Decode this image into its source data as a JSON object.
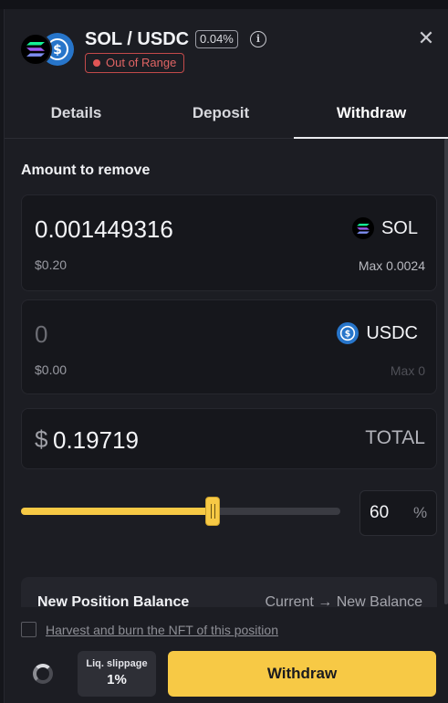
{
  "header": {
    "pair": "SOL / USDC",
    "fee": "0.04%",
    "status": "Out of Range",
    "token_a_icon": "solana-icon",
    "token_b_icon": "usdc-icon",
    "status_color": "#e05555"
  },
  "tabs": [
    {
      "label": "Details"
    },
    {
      "label": "Deposit"
    },
    {
      "label": "Withdraw",
      "active": true
    }
  ],
  "form": {
    "section_label": "Amount to remove",
    "token_a": {
      "amount": "0.001449316",
      "usd": "$0.20",
      "symbol": "SOL",
      "max": "Max 0.0024"
    },
    "token_b": {
      "amount": "0",
      "usd": "$0.00",
      "symbol": "USDC",
      "max": "Max 0"
    },
    "total": {
      "currency": "$",
      "value": "0.19719",
      "label": "TOTAL"
    },
    "slider": {
      "percent": 60
    },
    "percent_input": {
      "value": "60",
      "unit": "%"
    }
  },
  "position_balance": {
    "title": "New Position Balance",
    "current": "Current",
    "arrow": "→",
    "new": "New Balance"
  },
  "footer": {
    "harvest_label": "Harvest and burn the NFT of this position",
    "slippage_label": "Liq. slippage",
    "slippage_value": "1%",
    "withdraw_label": "Withdraw"
  },
  "colors": {
    "accent": "#f7c945",
    "panel": "#1c1d23",
    "card": "#16171c"
  }
}
